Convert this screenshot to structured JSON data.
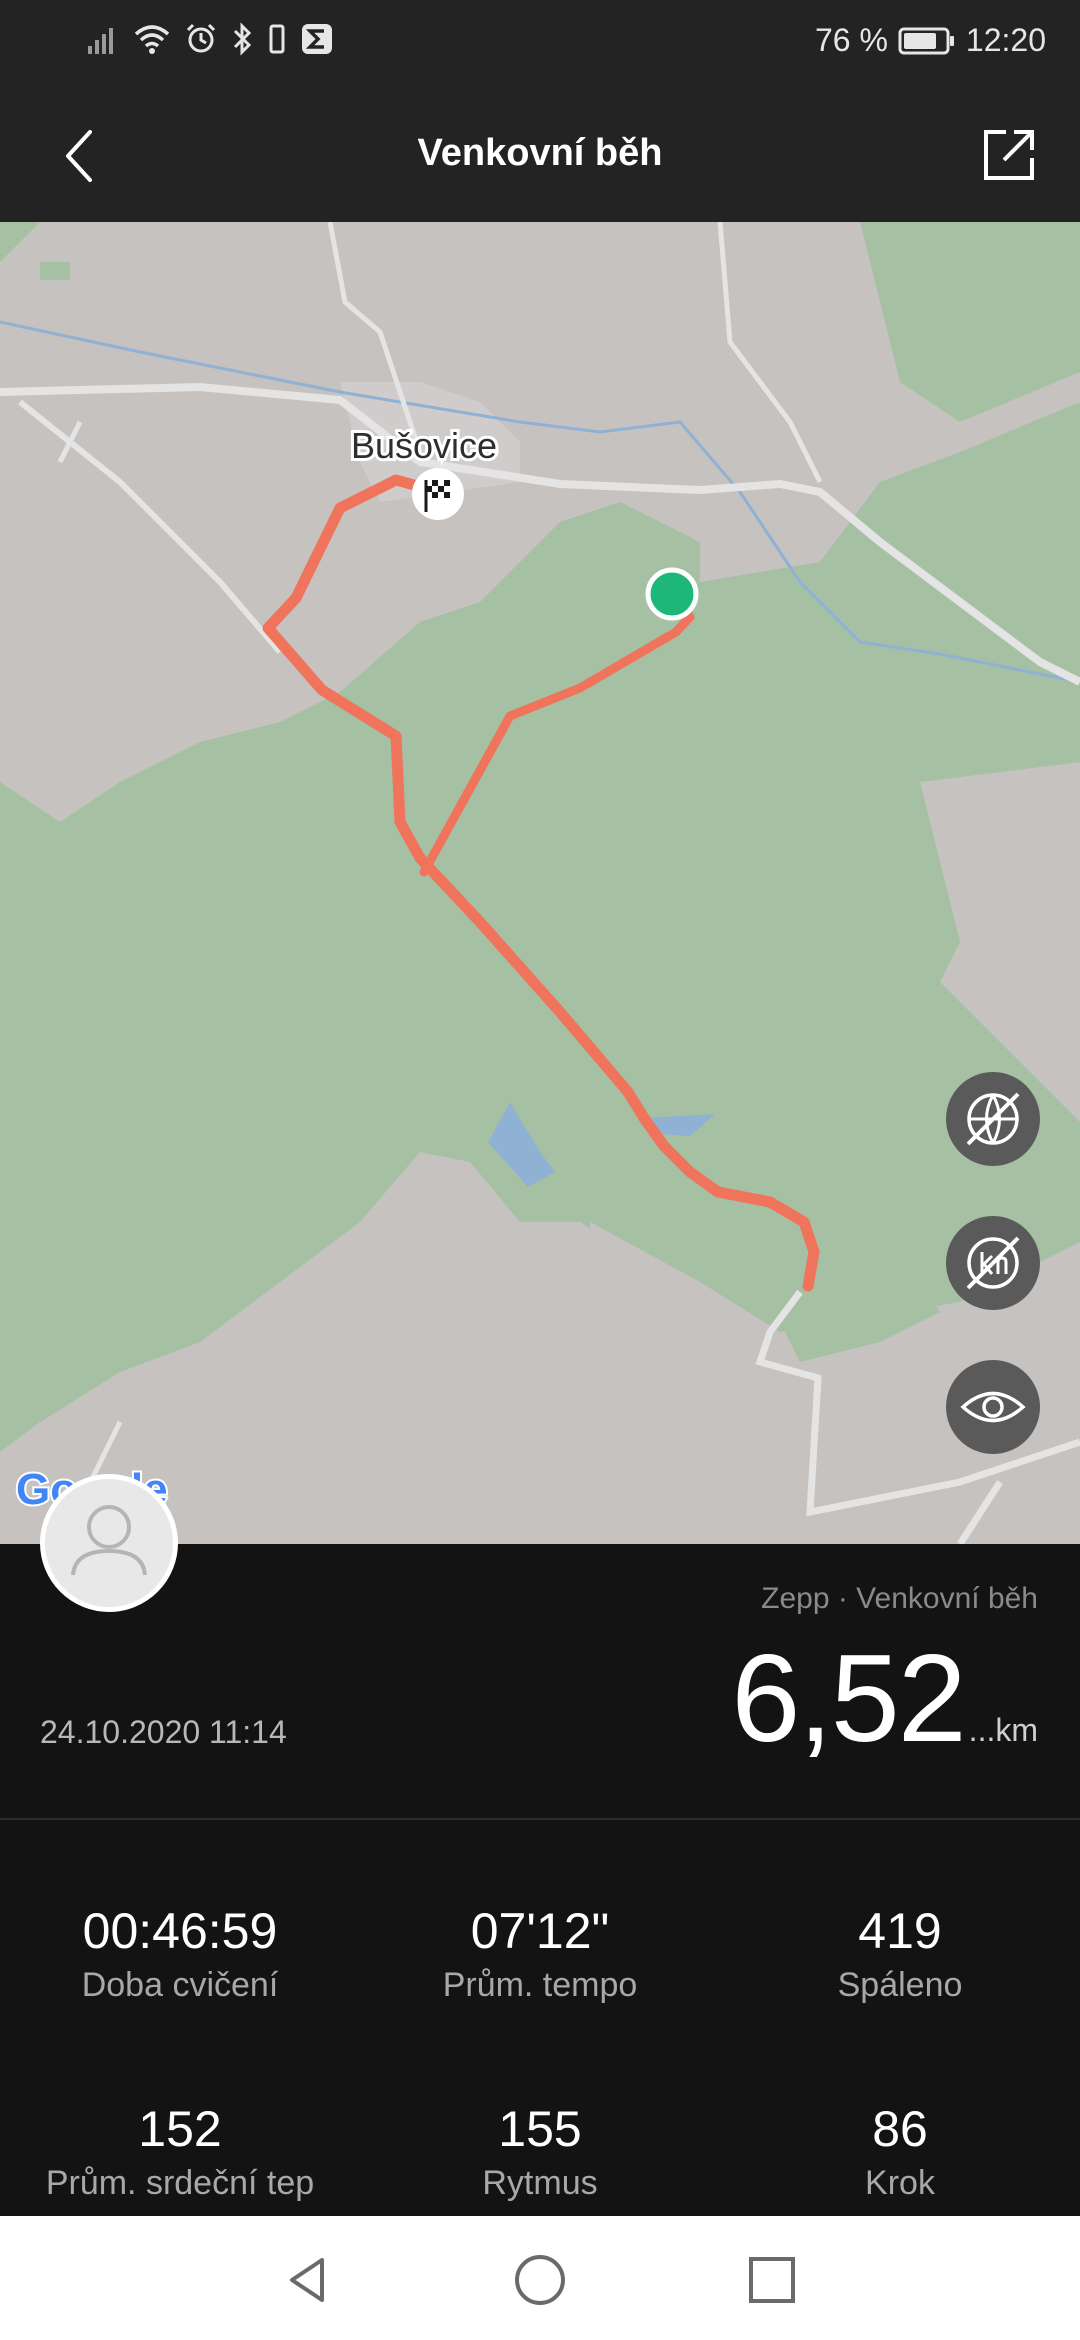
{
  "status_bar": {
    "battery_text": "76 %",
    "time": "12:20",
    "icons": [
      "signal-icon",
      "wifi-icon",
      "alarm-icon",
      "bluetooth-icon",
      "vibrate-icon",
      "app-sigma-icon",
      "battery-icon"
    ]
  },
  "header": {
    "title": "Venkovní běh",
    "back_icon": "back-arrow-icon",
    "share_icon": "share-icon"
  },
  "map": {
    "place_label": "Bušovice",
    "provider_label": "Google",
    "colors": {
      "route": "#f0745b",
      "start": "#1db77a",
      "forest": "#a6c0a3",
      "land": "#c5c2c0",
      "water": "#8fb1d4"
    },
    "controls": [
      "map-style-off-icon",
      "kilometer-markers-off-icon",
      "eye-icon"
    ]
  },
  "summary": {
    "source": "Zepp · Venkovní běh",
    "distance": "6,52",
    "distance_unit": "...km",
    "date": "24.10.2020 11:14"
  },
  "stats": [
    {
      "value": "00:46:59",
      "label": "Doba cvičení"
    },
    {
      "value": "07'12\"",
      "label": "Prům. tempo"
    },
    {
      "value": "419",
      "label": "Spáleno"
    },
    {
      "value": "152",
      "label": "Prům. srdeční tep"
    },
    {
      "value": "155",
      "label": "Rytmus"
    },
    {
      "value": "86",
      "label": "Krok"
    }
  ],
  "nav": {
    "icons": [
      "nav-back-icon",
      "nav-home-icon",
      "nav-recents-icon"
    ]
  }
}
